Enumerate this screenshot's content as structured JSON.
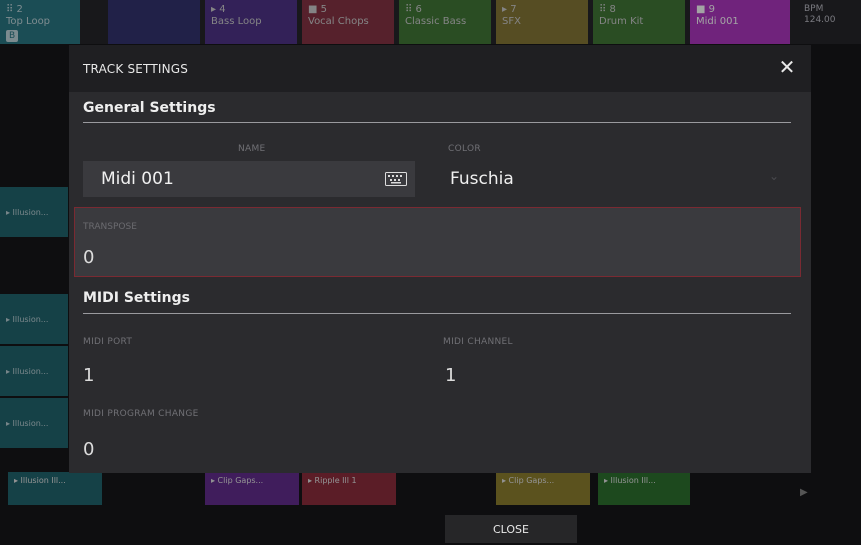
{
  "background": {
    "tracks": [
      {
        "num": "⠿ 2",
        "name": "Top Loop",
        "badge": "B",
        "color": "#1f7a86"
      },
      {
        "num": "",
        "name": "",
        "color": "#2a2a6e"
      },
      {
        "num": "▸ 4",
        "name": "Bass Loop",
        "color": "#4a2a8a"
      },
      {
        "num": "■ 5",
        "name": "Vocal Chops",
        "color": "#8a2a3a"
      },
      {
        "num": "⠿ 6",
        "name": "Classic Bass",
        "color": "#3a7a2a"
      },
      {
        "num": "▸ 7",
        "name": "SFX",
        "color": "#8a7a2a"
      },
      {
        "num": "⠿ 8",
        "name": "Drum Kit",
        "color": "#3a7a2a"
      },
      {
        "num": "■ 9",
        "name": "Midi 001",
        "color": "#a02ab0"
      }
    ],
    "bpm_label": "BPM",
    "bpm_value": "124.00",
    "side_clip_label": "▸ Illusion...",
    "bottom_clips": [
      "▸ Illusion Ill...",
      "▸ Clip Gaps...",
      "▸ Ripple Ill 1",
      "▸ Clip Gaps...",
      "▸ Illusion Ill..."
    ],
    "bottom_colors": [
      "#1c6b75",
      "#6a2a9a",
      "#9a2a3a",
      "#9a8a2a",
      "#2a7a2a"
    ],
    "play_icon": "play-arrow-icon"
  },
  "dialog": {
    "title": "TRACK SETTINGS",
    "close_icon": "close-icon",
    "general_section": "General Settings",
    "name_label": "NAME",
    "name_value": "Midi 001",
    "keyboard_icon": "keyboard-icon",
    "color_label": "COLOR",
    "color_value": "Fuschia",
    "transpose_label": "TRANSPOSE",
    "transpose_value": "0",
    "midi_section": "MIDI Settings",
    "midi_port_label": "MIDI PORT",
    "midi_port_value": "1",
    "midi_channel_label": "MIDI CHANNEL",
    "midi_channel_value": "1",
    "program_change_label": "MIDI PROGRAM CHANGE",
    "program_change_value": "0"
  },
  "footer": {
    "close_label": "CLOSE"
  },
  "colors": {
    "accent_border": "#7a2a32",
    "dialog_bg": "#2b2b2e",
    "field_bg": "#3a3a3e"
  }
}
